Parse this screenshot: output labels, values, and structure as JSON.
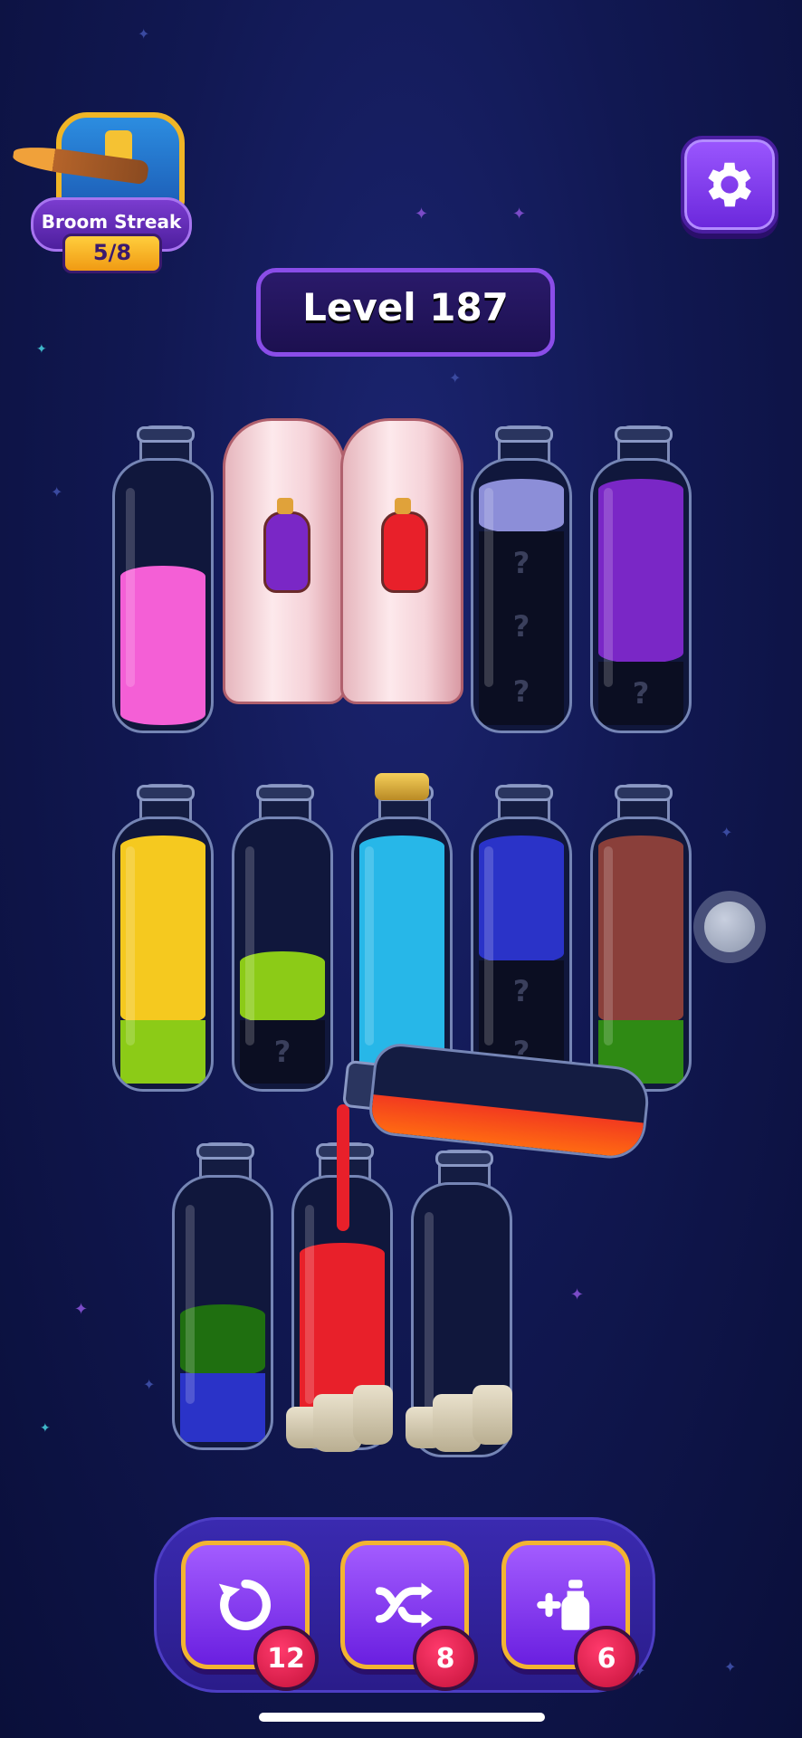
{
  "streak": {
    "label": "Broom Streak",
    "count": "5/8"
  },
  "level": {
    "label": "Level 187"
  },
  "colors": {
    "pink": "#f45fd6",
    "purple": "#7a27c6",
    "lavender": "#8c8ed8",
    "yellow": "#f5c91f",
    "lime": "#8ccb17",
    "cyan": "#27b7e8",
    "blue": "#2a33c8",
    "brown": "#8a3f3a",
    "green": "#2f8a14",
    "dark_green": "#1f6f10",
    "red": "#e8202a",
    "orange": "#ff6a12",
    "hidden": "#0b0e22"
  },
  "unknown_mark": "?",
  "bottles_row1": [
    {
      "id": "b1",
      "layers": [
        "pink",
        "pink",
        "pink"
      ],
      "hidden": 0
    },
    {
      "id": "b2",
      "covered": true,
      "potion": "purple"
    },
    {
      "id": "b3",
      "covered": true,
      "potion": "red"
    },
    {
      "id": "b4",
      "layers": [
        "hidden",
        "hidden",
        "hidden",
        "lavender"
      ],
      "hidden": 3
    },
    {
      "id": "b5",
      "layers": [
        "hidden",
        "purple",
        "purple",
        "purple"
      ],
      "hidden": 1
    }
  ],
  "bottles_row2": [
    {
      "id": "b6",
      "layers": [
        "lime",
        "yellow",
        "yellow",
        "yellow"
      ]
    },
    {
      "id": "b7",
      "layers": [
        "hidden",
        "lime"
      ]
    },
    {
      "id": "b8",
      "layers": [
        "cyan",
        "cyan",
        "cyan",
        "cyan"
      ],
      "corked": true
    },
    {
      "id": "b9",
      "layers": [
        "hidden",
        "hidden",
        "blue",
        "blue"
      ]
    },
    {
      "id": "b10",
      "layers": [
        "green",
        "brown",
        "brown",
        "brown"
      ]
    }
  ],
  "bottles_row3": [
    {
      "id": "b11",
      "layers": [
        "blue",
        "dark_green"
      ]
    },
    {
      "id": "b12",
      "layers": [
        "red",
        "red",
        "red"
      ],
      "rocks": true
    },
    {
      "id": "b13",
      "layers": [],
      "rocks": true
    }
  ],
  "tools": [
    {
      "id": "undo",
      "icon": "undo-icon",
      "count": "12"
    },
    {
      "id": "shuffle",
      "icon": "shuffle-icon",
      "count": "8"
    },
    {
      "id": "add-bottle",
      "icon": "add-bottle-icon",
      "count": "6"
    }
  ]
}
